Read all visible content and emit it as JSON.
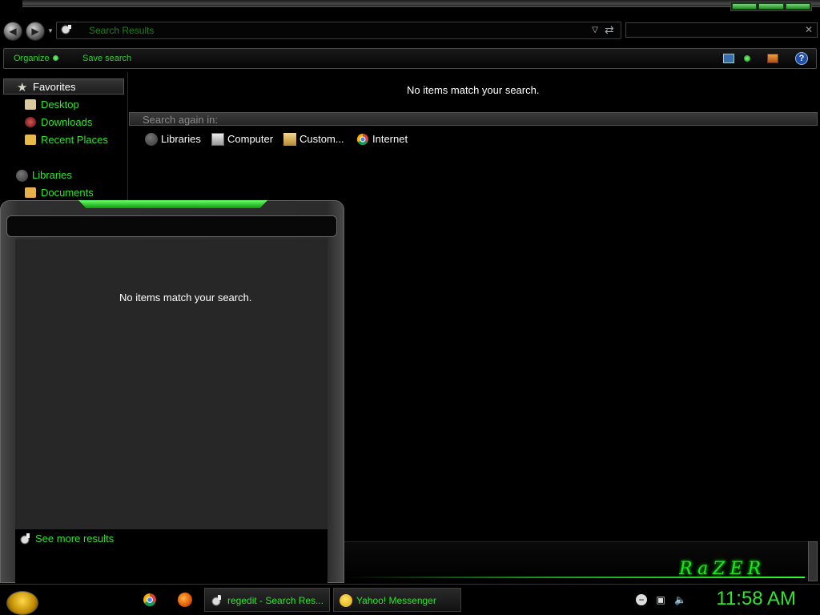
{
  "colors": {
    "accent": "#2de62d",
    "background": "#000000",
    "panel": "#272727"
  },
  "address_bar": {
    "path": "Search Results",
    "search_placeholder": ""
  },
  "command_bar": {
    "organize": "Organize",
    "save_search": "Save search"
  },
  "nav_pane": {
    "favorites_header": "Favorites",
    "favorites": [
      {
        "label": "Desktop",
        "icon": "desktop-icon"
      },
      {
        "label": "Downloads",
        "icon": "downloads-icon"
      },
      {
        "label": "Recent Places",
        "icon": "recent-places-icon"
      }
    ],
    "libraries_header": "Libraries",
    "libraries": [
      {
        "label": "Documents",
        "icon": "documents-icon"
      }
    ]
  },
  "main": {
    "no_items": "No items match your search.",
    "search_again_label": "Search again in:",
    "search_again_items": [
      {
        "label": "Libraries",
        "icon": "libraries-icon"
      },
      {
        "label": "Computer",
        "icon": "computer-icon"
      },
      {
        "label": "Custom...",
        "icon": "custom-icon"
      },
      {
        "label": "Internet",
        "icon": "chrome-icon"
      }
    ]
  },
  "start_menu": {
    "no_items": "No items match your search.",
    "see_more": "See more results"
  },
  "taskbar": {
    "tasks": [
      {
        "label": "regedit - Search Res...",
        "icon": "search-folder-icon"
      },
      {
        "label": "Yahoo! Messenger",
        "icon": "yahoo-messenger-icon"
      }
    ],
    "clock": "11:58 AM"
  }
}
